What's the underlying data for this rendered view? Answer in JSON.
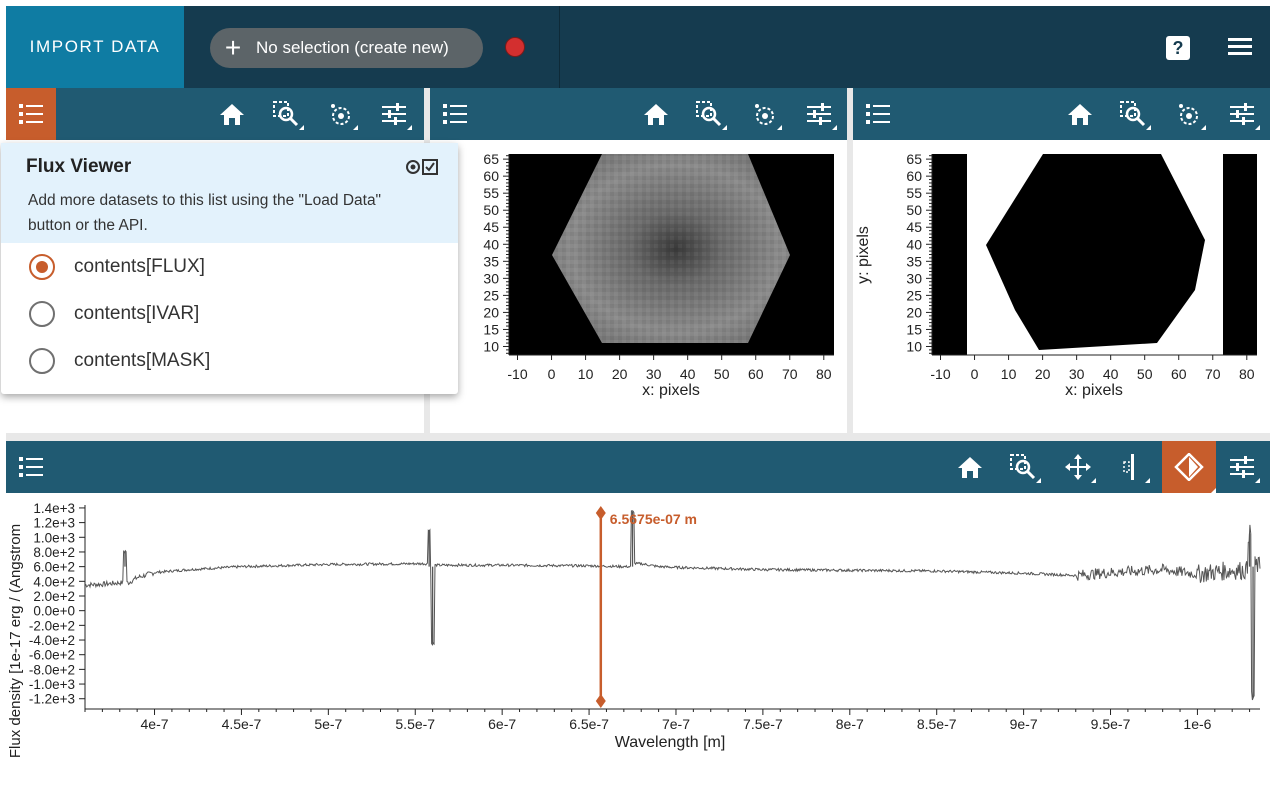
{
  "topbar": {
    "import_label": "IMPORT DATA",
    "subset_plus": "+",
    "subset_label": "No selection (create new)",
    "help_label": "?",
    "accent_color": "#0f7ca3",
    "record_color": "#d32f2f"
  },
  "viewers": {
    "top_left_tools": [
      "home-icon",
      "zoom-icon",
      "lasso-icon",
      "settings-icon"
    ],
    "top_mid_tools": [
      "home-icon",
      "zoom-icon",
      "lasso-icon",
      "settings-icon"
    ],
    "top_right_tools": [
      "home-icon",
      "zoom-icon",
      "lasso-icon",
      "settings-icon"
    ],
    "spectrum_tools": [
      "home-icon",
      "zoom-icon",
      "pan-icon",
      "slice-icon",
      "line-select-icon",
      "settings-icon"
    ]
  },
  "data_menu": {
    "title": "Flux Viewer",
    "hint": "Add more datasets to this list using the \"Load Data\" button or the API.",
    "items": [
      {
        "label": "contents[FLUX]",
        "selected": true
      },
      {
        "label": "contents[IVAR]",
        "selected": false
      },
      {
        "label": "contents[MASK]",
        "selected": false
      }
    ]
  },
  "image_viewer_1": {
    "xlabel": "x: pixels",
    "x_ticks": [
      "-10",
      "0",
      "10",
      "20",
      "30",
      "40",
      "50",
      "60",
      "70",
      "80"
    ],
    "y_ticks": [
      "10",
      "15",
      "20",
      "25",
      "30",
      "35",
      "40",
      "45",
      "50",
      "55",
      "60",
      "65"
    ]
  },
  "image_viewer_2": {
    "xlabel": "x: pixels",
    "ylabel": "y: pixels",
    "x_ticks": [
      "-10",
      "0",
      "10",
      "20",
      "30",
      "40",
      "50",
      "60",
      "70",
      "80"
    ],
    "y_ticks": [
      "10",
      "15",
      "20",
      "25",
      "30",
      "35",
      "40",
      "45",
      "50",
      "55",
      "60",
      "65"
    ]
  },
  "chart_data": {
    "type": "line",
    "xlabel": "Wavelength [m]",
    "ylabel": "Flux density [1e-17 erg / (Angstrom",
    "x_ticks": [
      "4e-7",
      "4.5e-7",
      "5e-7",
      "5.5e-7",
      "6e-7",
      "6.5e-7",
      "7e-7",
      "7.5e-7",
      "8e-7",
      "8.5e-7",
      "9e-7",
      "9.5e-7",
      "1e-6"
    ],
    "y_ticks": [
      "1.4e+3",
      "1.2e+3",
      "1.0e+3",
      "8.0e+2",
      "6.0e+2",
      "4.0e+2",
      "2.0e+2",
      "0.0e+0",
      "-2.0e+2",
      "-4.0e+2",
      "-6.0e+2",
      "-8.0e+2",
      "-1.0e+3",
      "-1.2e+3"
    ],
    "xlim": [
      3.6e-07,
      1.036e-06
    ],
    "ylim": [
      -1340.0,
      1440.0
    ],
    "series": [
      {
        "color": "#555555",
        "x": [
          3.6e-07,
          3.7e-07,
          3.8e-07,
          3.83e-07,
          3.85e-07,
          3.9e-07,
          4e-07,
          4.2e-07,
          4.5e-07,
          5e-07,
          5.5e-07,
          5.58e-07,
          5.6e-07,
          5.62e-07,
          6e-07,
          6.56e-07,
          6.7e-07,
          6.75e-07,
          6.8e-07,
          6.9e-07,
          7e-07,
          7.5e-07,
          8e-07,
          8.5e-07,
          9e-07,
          9.3e-07,
          9.5e-07,
          9.8e-07,
          1e-06,
          1.02e-06,
          1.03e-06,
          1.032e-06,
          1.034e-06,
          1.036e-06
        ],
        "y": [
          350,
          360,
          380,
          810,
          380,
          450,
          520,
          560,
          600,
          630,
          640,
          1100,
          -450,
          620,
          620,
          610,
          600,
          1350,
          640,
          600,
          590,
          560,
          550,
          540,
          510,
          480,
          520,
          560,
          500,
          550,
          1050,
          -1180,
          620,
          600
        ]
      }
    ],
    "marker": {
      "label": "6.5675e-07 m",
      "x": 6.5675e-07,
      "color": "#c75d2c"
    }
  }
}
